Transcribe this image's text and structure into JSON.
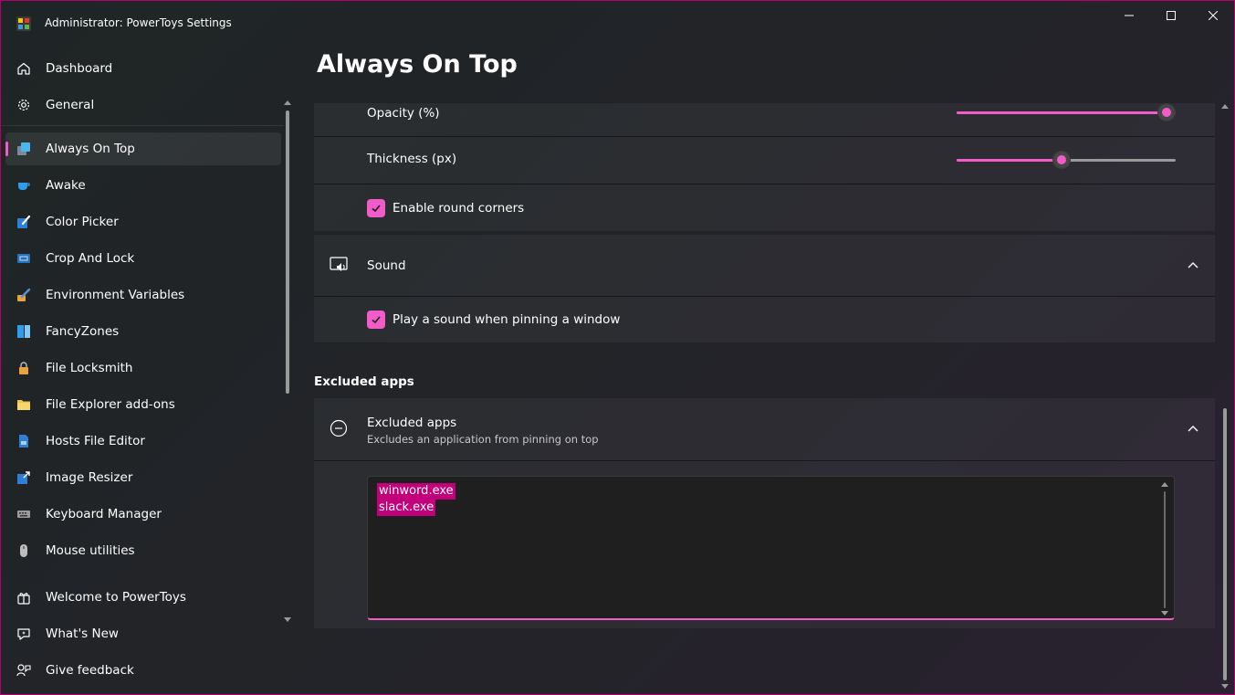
{
  "window": {
    "title": "Administrator: PowerToys Settings"
  },
  "sidebar": {
    "items": [
      {
        "label": "Dashboard",
        "icon": "home-icon"
      },
      {
        "label": "General",
        "icon": "gear-icon"
      },
      {
        "label": "Always On Top",
        "icon": "always-on-top-icon",
        "selected": true
      },
      {
        "label": "Awake",
        "icon": "awake-cup-icon"
      },
      {
        "label": "Color Picker",
        "icon": "color-picker-icon"
      },
      {
        "label": "Crop And Lock",
        "icon": "crop-and-lock-icon"
      },
      {
        "label": "Environment Variables",
        "icon": "environment-variables-icon"
      },
      {
        "label": "FancyZones",
        "icon": "fancyzones-icon"
      },
      {
        "label": "File Locksmith",
        "icon": "file-locksmith-icon"
      },
      {
        "label": "File Explorer add-ons",
        "icon": "folder-icon"
      },
      {
        "label": "Hosts File Editor",
        "icon": "hosts-file-icon"
      },
      {
        "label": "Image Resizer",
        "icon": "image-resizer-icon"
      },
      {
        "label": "Keyboard Manager",
        "icon": "keyboard-icon"
      },
      {
        "label": "Mouse utilities",
        "icon": "mouse-icon"
      }
    ],
    "footer_items": [
      {
        "label": "Welcome to PowerToys",
        "icon": "welcome-icon"
      },
      {
        "label": "What's New",
        "icon": "whats-new-icon"
      },
      {
        "label": "Give feedback",
        "icon": "feedback-icon"
      }
    ]
  },
  "main": {
    "page_title": "Always On Top",
    "opacity": {
      "label": "Opacity (%)",
      "value": 96
    },
    "thickness": {
      "label": "Thickness (px)",
      "value": 48
    },
    "round_corners": {
      "label": "Enable round corners",
      "checked": true
    },
    "sound": {
      "label": "Sound",
      "icon": "sound-icon"
    },
    "play_sound": {
      "label": "Play a sound when pinning a window",
      "checked": true
    },
    "excluded_section_header": "Excluded apps",
    "excluded_apps": {
      "title": "Excluded apps",
      "description": "Excludes an application from pinning on top",
      "icon": "minus-circle-icon",
      "lines": [
        "winword.exe",
        "slack.exe"
      ]
    }
  },
  "colors": {
    "accent": "#f25cc8",
    "selection": "#c2007c",
    "window_border": "#b4006c"
  }
}
